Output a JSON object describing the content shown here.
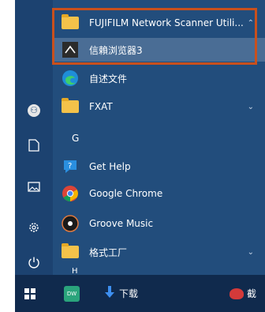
{
  "rail": {
    "items": [
      "user-avatar",
      "documents",
      "pictures",
      "settings",
      "power"
    ]
  },
  "apps": [
    {
      "label": "FUJIFILM Network Scanner Utili...",
      "icon": "folder-icon",
      "chevron": "⌃"
    },
    {
      "label": "信賴浏览器3",
      "icon": "browser-icon"
    },
    {
      "label": "自述文件",
      "icon": "edge-icon"
    },
    {
      "label": "FXAT",
      "icon": "folder-icon",
      "chevron": "⌄"
    },
    {
      "label": "Get Help",
      "icon": "help-icon"
    },
    {
      "label": "Google Chrome",
      "icon": "chrome-icon"
    },
    {
      "label": "Groove Music",
      "icon": "music-icon"
    },
    {
      "label": "格式工厂",
      "icon": "folder-icon",
      "chevron": "⌄"
    }
  ],
  "group_letters": [
    "G",
    "H"
  ],
  "taskbar": {
    "dw_label": "DW",
    "download_label": "下载",
    "screenshot_label": "截"
  },
  "colors": {
    "menu_bg": "#224d7c",
    "highlight": "#4a6d95",
    "annotation_box": "#c9501d",
    "taskbar_bg": "#102a4d"
  }
}
